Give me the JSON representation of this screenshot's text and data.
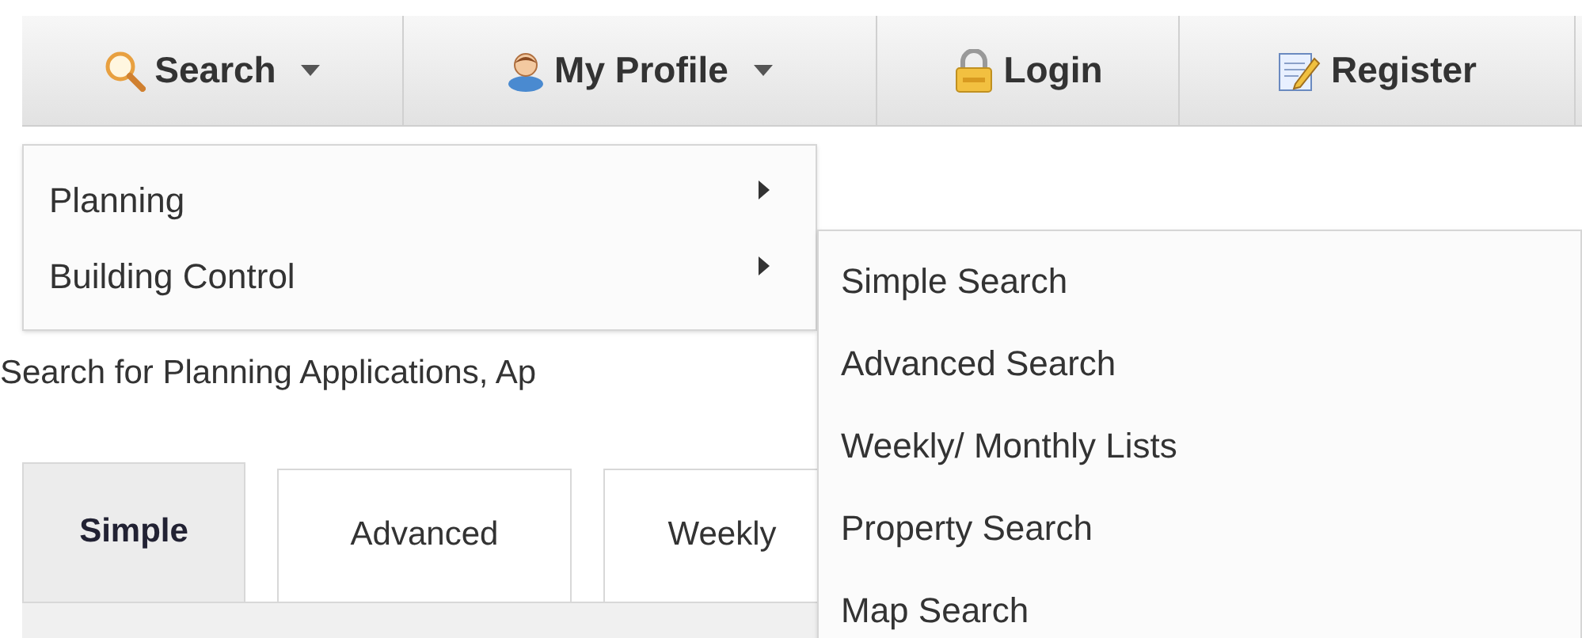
{
  "nav": [
    {
      "label": "Search",
      "dropdown": true
    },
    {
      "label": "My Profile",
      "dropdown": true
    },
    {
      "label": "Login",
      "dropdown": false
    },
    {
      "label": "Register",
      "dropdown": false
    }
  ],
  "menu": [
    {
      "label": "Planning",
      "submenu": true
    },
    {
      "label": "Building Control",
      "submenu": true
    }
  ],
  "submenu": [
    {
      "label": "Simple Search"
    },
    {
      "label": "Advanced Search"
    },
    {
      "label": "Weekly/ Monthly Lists"
    },
    {
      "label": "Property Search"
    },
    {
      "label": "Map Search"
    }
  ],
  "intro": "Search for Planning Applications, Ap",
  "tabs": [
    {
      "label": "Simple",
      "selected": true
    },
    {
      "label": "Advanced",
      "selected": false
    },
    {
      "label": "Weekly",
      "selected": false
    }
  ]
}
